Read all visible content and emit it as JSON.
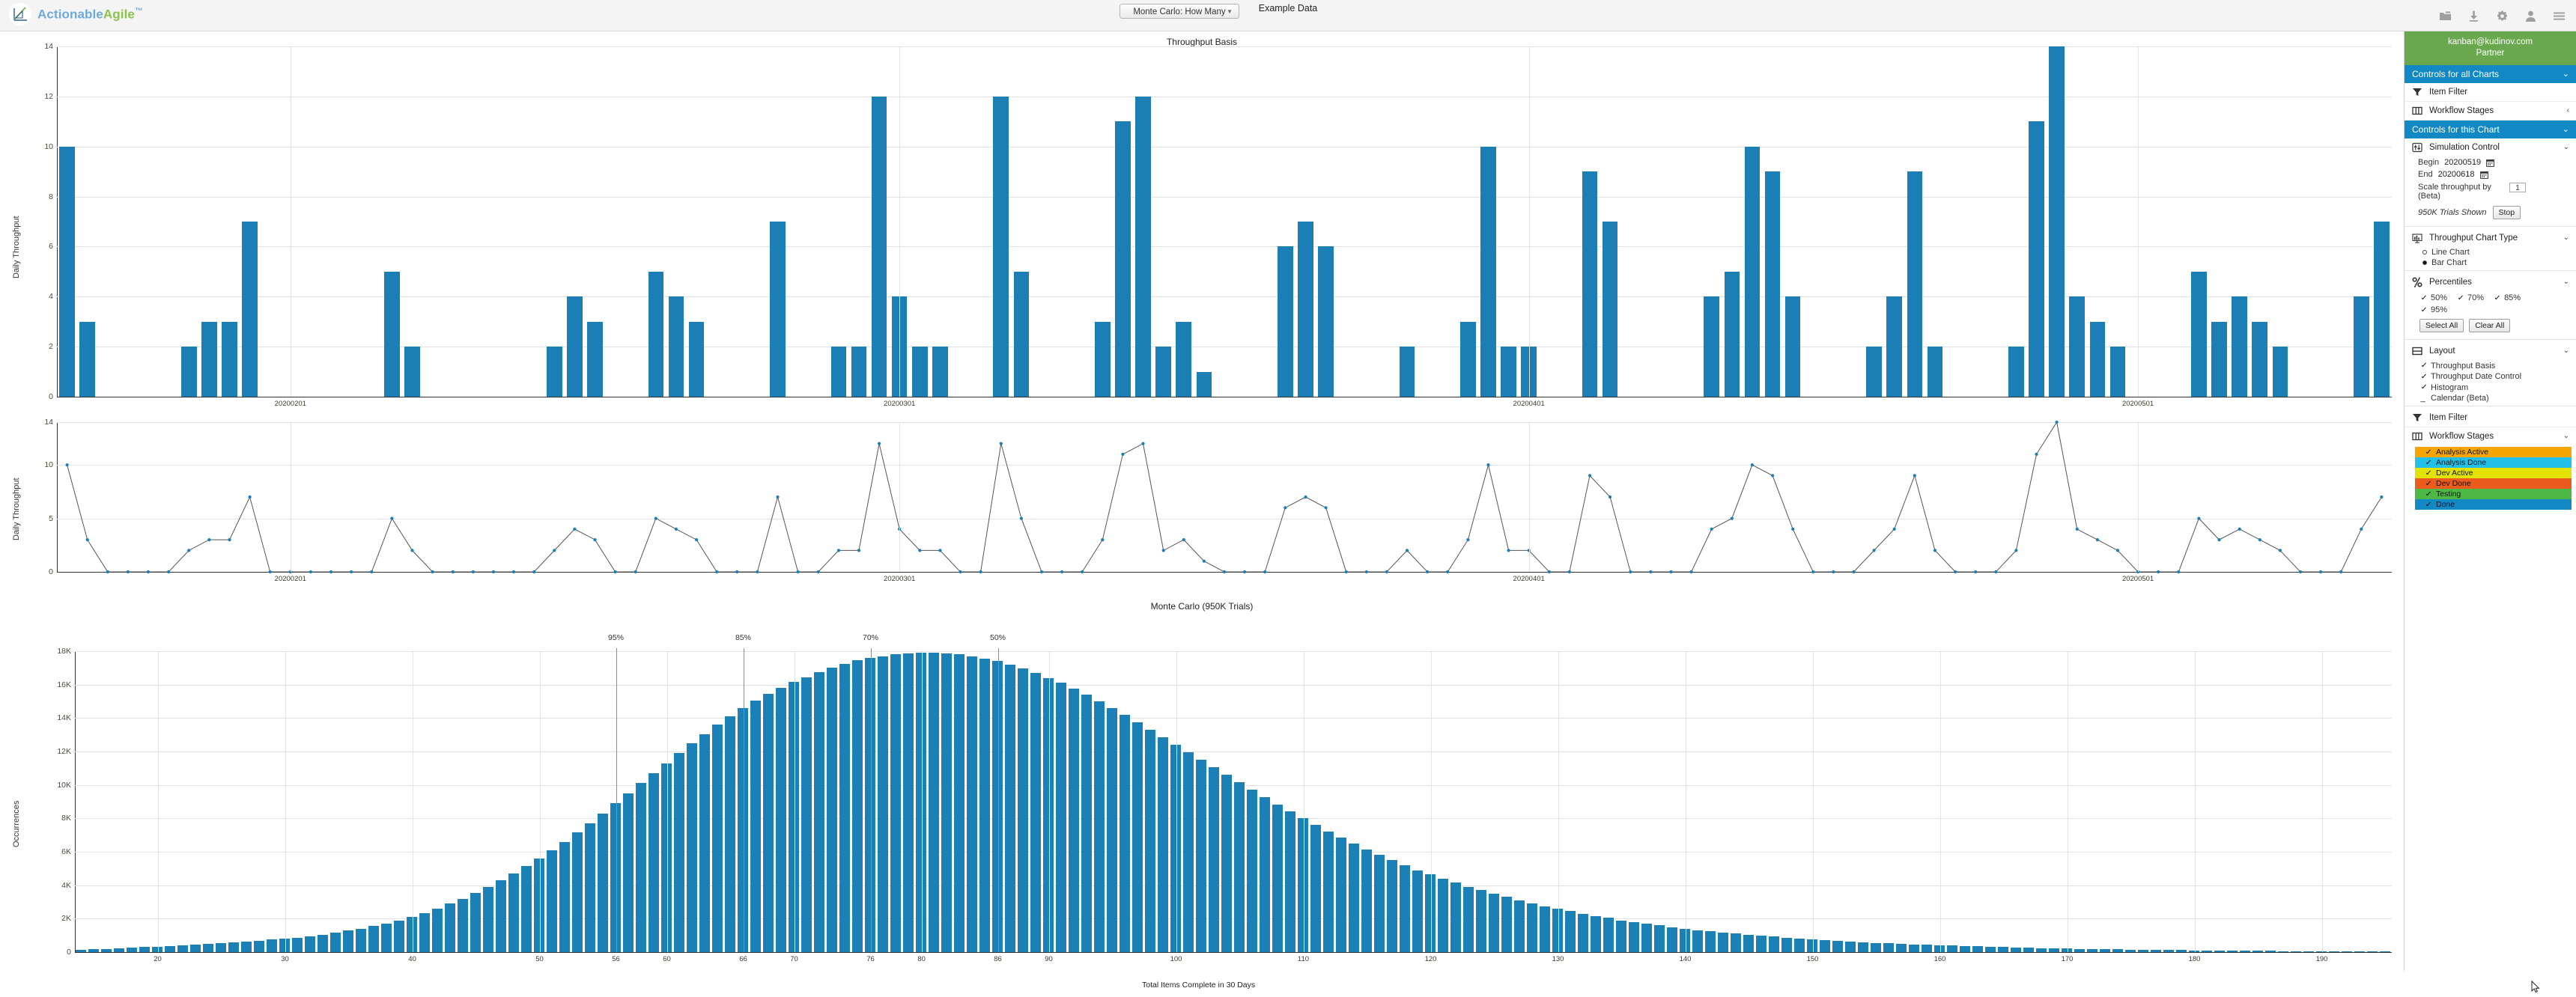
{
  "app": {
    "brand_action": "Actionable",
    "brand_agile": "Agile",
    "brand_tm": "™",
    "chart_selector": "Monte Carlo: How Many",
    "chart_selector_caret": "▼",
    "document_name": "Example Data",
    "top_icons": [
      "folder-icon",
      "download-icon",
      "gear-icon",
      "user-icon",
      "menu-icon"
    ]
  },
  "sidebar": {
    "account_email": "kanban@kudinov.com",
    "account_role": "Partner",
    "all_charts_header": "Controls for all Charts",
    "this_chart_header": "Controls for this Chart",
    "global_items": [
      {
        "label": "Item Filter",
        "icon": "filter-icon",
        "chev": ""
      },
      {
        "label": "Workflow Stages",
        "icon": "columns-icon",
        "chev": "‹"
      }
    ],
    "simulation": {
      "title": "Simulation Control",
      "icon": "sliders-icon",
      "chev": "⌄",
      "begin_label": "Begin",
      "begin_value": "20200519",
      "end_label": "End",
      "end_value": "20200618",
      "scale_label": "Scale throughput by (Beta)",
      "scale_value": "1",
      "trials_text": "950K Trials Shown",
      "stop_label": "Stop"
    },
    "chart_type": {
      "title": "Throughput Chart Type",
      "icon": "barchart-icon",
      "chev": "⌄",
      "options": [
        {
          "label": "Line Chart",
          "selected": false
        },
        {
          "label": "Bar Chart",
          "selected": true
        }
      ]
    },
    "percentiles": {
      "title": "Percentiles",
      "icon": "percent-icon",
      "chev": "⌄",
      "items": [
        {
          "label": "50%",
          "checked": true
        },
        {
          "label": "70%",
          "checked": true
        },
        {
          "label": "85%",
          "checked": true
        },
        {
          "label": "95%",
          "checked": true
        }
      ],
      "select_all": "Select All",
      "clear_all": "Clear All"
    },
    "layout": {
      "title": "Layout",
      "icon": "layout-icon",
      "chev": "⌄",
      "items": [
        {
          "label": "Throughput Basis",
          "checked": true
        },
        {
          "label": "Throughput Date Control",
          "checked": true
        },
        {
          "label": "Histogram",
          "checked": true
        },
        {
          "label": "Calendar (Beta)",
          "checked": false
        }
      ]
    },
    "item_filter": {
      "label": "Item Filter",
      "icon": "filter-icon"
    },
    "workflow_stages": {
      "title": "Workflow Stages",
      "icon": "columns-icon",
      "chev": "⌄",
      "stages": [
        {
          "label": "Analysis Active",
          "color": "#f6a400",
          "checked": true
        },
        {
          "label": "Analysis Done",
          "color": "#22c0e8",
          "checked": true
        },
        {
          "label": "Dev Active",
          "color": "#e3e300",
          "checked": true
        },
        {
          "label": "Dev Done",
          "color": "#ea5b1d",
          "checked": true
        },
        {
          "label": "Testing",
          "color": "#4eb847",
          "checked": true
        },
        {
          "label": "Done",
          "color": "#1289c5",
          "checked": true
        }
      ]
    }
  },
  "chart_data": [
    {
      "type": "bar",
      "title": "Throughput Basis",
      "xlabel": "",
      "ylabel": "Daily Throughput",
      "ylim": [
        0,
        14
      ],
      "yticks": [
        0,
        2,
        4,
        6,
        8,
        10,
        12,
        14
      ],
      "xticks": [
        "20200201",
        "20200301",
        "20200401",
        "20200501"
      ],
      "xtick_positions": [
        11,
        41,
        72,
        102
      ],
      "grid": true,
      "bar_color": "#1b7fb5",
      "values": [
        10,
        3,
        0,
        0,
        0,
        0,
        2,
        3,
        3,
        7,
        0,
        0,
        0,
        0,
        0,
        0,
        5,
        2,
        0,
        0,
        0,
        0,
        0,
        0,
        2,
        4,
        3,
        0,
        0,
        5,
        4,
        3,
        0,
        0,
        0,
        7,
        0,
        0,
        2,
        2,
        12,
        4,
        2,
        2,
        0,
        0,
        12,
        5,
        0,
        0,
        0,
        3,
        11,
        12,
        2,
        3,
        1,
        0,
        0,
        0,
        6,
        7,
        6,
        0,
        0,
        0,
        2,
        0,
        0,
        3,
        10,
        2,
        2,
        0,
        0,
        9,
        7,
        0,
        0,
        0,
        0,
        4,
        5,
        10,
        9,
        4,
        0,
        0,
        0,
        2,
        4,
        9,
        2,
        0,
        0,
        0,
        2,
        11,
        14,
        4,
        3,
        2,
        0,
        0,
        0,
        5,
        3,
        4,
        3,
        2,
        0,
        0,
        0,
        4,
        7
      ]
    },
    {
      "type": "line",
      "title": "",
      "xlabel": "",
      "ylabel": "Daily Throughput",
      "ylim": [
        0,
        14
      ],
      "yticks": [
        0,
        5,
        10,
        14
      ],
      "xticks": [
        "20200201",
        "20200301",
        "20200401",
        "20200501"
      ],
      "xtick_positions": [
        11,
        41,
        72,
        102
      ],
      "line_color": "#555555",
      "marker_color": "#1b7fb5",
      "values": [
        10,
        3,
        0,
        0,
        0,
        0,
        2,
        3,
        3,
        7,
        0,
        0,
        0,
        0,
        0,
        0,
        5,
        2,
        0,
        0,
        0,
        0,
        0,
        0,
        2,
        4,
        3,
        0,
        0,
        5,
        4,
        3,
        0,
        0,
        0,
        7,
        0,
        0,
        2,
        2,
        12,
        4,
        2,
        2,
        0,
        0,
        12,
        5,
        0,
        0,
        0,
        3,
        11,
        12,
        2,
        3,
        1,
        0,
        0,
        0,
        6,
        7,
        6,
        0,
        0,
        0,
        2,
        0,
        0,
        3,
        10,
        2,
        2,
        0,
        0,
        9,
        7,
        0,
        0,
        0,
        0,
        4,
        5,
        10,
        9,
        4,
        0,
        0,
        0,
        2,
        4,
        9,
        2,
        0,
        0,
        0,
        2,
        11,
        14,
        4,
        3,
        2,
        0,
        0,
        0,
        5,
        3,
        4,
        3,
        2,
        0,
        0,
        0,
        4,
        7
      ]
    },
    {
      "type": "bar",
      "title": "Monte Carlo (950K Trials)",
      "xlabel": "Total Items Complete in 30 Days",
      "ylabel": "Occurrences",
      "ylim": [
        0,
        18000
      ],
      "yticks": [
        "0",
        "2K",
        "4K",
        "6K",
        "8K",
        "10K",
        "12K",
        "14K",
        "16K",
        "18K"
      ],
      "xlim": [
        14,
        196
      ],
      "xticks": [
        20,
        30,
        40,
        50,
        56,
        60,
        66,
        70,
        76,
        80,
        86,
        90,
        100,
        110,
        120,
        130,
        140,
        150,
        160,
        170,
        180,
        190
      ],
      "bar_color": "#1b80b6",
      "percentile_markers": [
        {
          "label": "95%",
          "x": 56
        },
        {
          "label": "85%",
          "x": 66
        },
        {
          "label": "70%",
          "x": 76
        },
        {
          "label": "50%",
          "x": 86
        }
      ],
      "x": [
        14,
        15,
        16,
        17,
        18,
        19,
        20,
        21,
        22,
        23,
        24,
        25,
        26,
        27,
        28,
        29,
        30,
        31,
        32,
        33,
        34,
        35,
        36,
        37,
        38,
        39,
        40,
        41,
        42,
        43,
        44,
        45,
        46,
        47,
        48,
        49,
        50,
        51,
        52,
        53,
        54,
        55,
        56,
        57,
        58,
        59,
        60,
        61,
        62,
        63,
        64,
        65,
        66,
        67,
        68,
        69,
        70,
        71,
        72,
        73,
        74,
        75,
        76,
        77,
        78,
        79,
        80,
        81,
        82,
        83,
        84,
        85,
        86,
        87,
        88,
        89,
        90,
        91,
        92,
        93,
        94,
        95,
        96,
        97,
        98,
        99,
        100,
        101,
        102,
        103,
        104,
        105,
        106,
        107,
        108,
        109,
        110,
        111,
        112,
        113,
        114,
        115,
        116,
        117,
        118,
        119,
        120,
        121,
        122,
        123,
        124,
        125,
        126,
        127,
        128,
        129,
        130,
        131,
        132,
        133,
        134,
        135,
        136,
        137,
        138,
        139,
        140,
        141,
        142,
        143,
        144,
        145,
        146,
        147,
        148,
        149,
        150,
        151,
        152,
        153,
        154,
        155,
        156,
        157,
        158,
        159,
        160,
        161,
        162,
        163,
        164,
        165,
        166,
        167,
        168,
        169,
        170,
        171,
        172,
        173,
        174,
        175,
        176,
        177,
        178,
        179,
        180,
        181,
        182,
        183,
        184,
        185,
        186,
        187,
        188,
        189,
        190,
        191,
        192,
        193,
        194,
        195
      ],
      "values": [
        150,
        170,
        190,
        220,
        250,
        300,
        330,
        360,
        400,
        440,
        480,
        520,
        570,
        620,
        680,
        740,
        800,
        870,
        950,
        1050,
        1150,
        1280,
        1400,
        1550,
        1700,
        1900,
        2100,
        2350,
        2600,
        2900,
        3200,
        3550,
        3900,
        4300,
        4700,
        5150,
        5600,
        6100,
        6600,
        7150,
        7700,
        8300,
        8900,
        9500,
        10100,
        10700,
        11300,
        11900,
        12500,
        13050,
        13600,
        14100,
        14600,
        15050,
        15450,
        15800,
        16150,
        16450,
        16750,
        17000,
        17250,
        17450,
        17600,
        17700,
        17800,
        17850,
        17900,
        17900,
        17850,
        17800,
        17700,
        17550,
        17400,
        17200,
        16950,
        16700,
        16400,
        16100,
        15750,
        15400,
        15000,
        14600,
        14200,
        13750,
        13300,
        12850,
        12400,
        11950,
        11500,
        11050,
        10600,
        10150,
        9700,
        9250,
        8800,
        8400,
        8000,
        7600,
        7200,
        6850,
        6500,
        6150,
        5800,
        5500,
        5200,
        4900,
        4650,
        4400,
        4150,
        3900,
        3700,
        3500,
        3300,
        3100,
        2900,
        2750,
        2600,
        2450,
        2300,
        2150,
        2050,
        1900,
        1800,
        1700,
        1600,
        1500,
        1400,
        1320,
        1250,
        1180,
        1100,
        1050,
        980,
        920,
        870,
        820,
        770,
        720,
        680,
        640,
        600,
        560,
        530,
        500,
        470,
        440,
        410,
        390,
        360,
        340,
        320,
        300,
        280,
        260,
        245,
        230,
        215,
        200,
        190,
        175,
        165,
        155,
        145,
        135,
        125,
        115,
        108,
        100,
        93,
        86,
        80,
        74,
        68,
        63,
        58,
        54,
        50,
        46,
        42,
        39,
        36,
        33,
        30
      ]
    }
  ]
}
